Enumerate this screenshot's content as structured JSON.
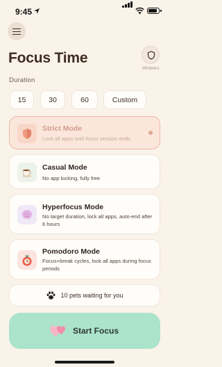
{
  "status_bar": {
    "time": "9:45"
  },
  "header": {
    "menu_icon": "hamburger-icon",
    "title": "Focus Time",
    "whitelist_icon": "shield-icon",
    "whitelist_label": "Whitelist"
  },
  "duration": {
    "label": "Duration",
    "options": [
      "15",
      "30",
      "60",
      "Custom"
    ]
  },
  "modes": [
    {
      "title": "Strict Mode",
      "description": "Lock all apps until focus session ends",
      "icon": "shield-icon",
      "selected": true
    },
    {
      "title": "Casual Mode",
      "description": "No app locking, fully free",
      "icon": "coffee-cup-icon",
      "selected": false
    },
    {
      "title": "Hyperfocus Mode",
      "description": "No target duration, lock all apps, auto-end after 6 hours",
      "icon": "brain-icon",
      "selected": false
    },
    {
      "title": "Pomodoro Mode",
      "description": "Focus+break cycles, lock all apps during focus periods",
      "icon": "tomato-icon",
      "selected": false
    }
  ],
  "pets": {
    "icon": "paw-icon",
    "text": "10 pets waiting for you"
  },
  "start_button": {
    "label": "Start Focus",
    "icon": "hearts-icon"
  },
  "colors": {
    "background": "#faf3ea",
    "accent_green": "#abe3cb",
    "selected_card": "#fbe6dc",
    "selected_border": "#efb7a5"
  }
}
